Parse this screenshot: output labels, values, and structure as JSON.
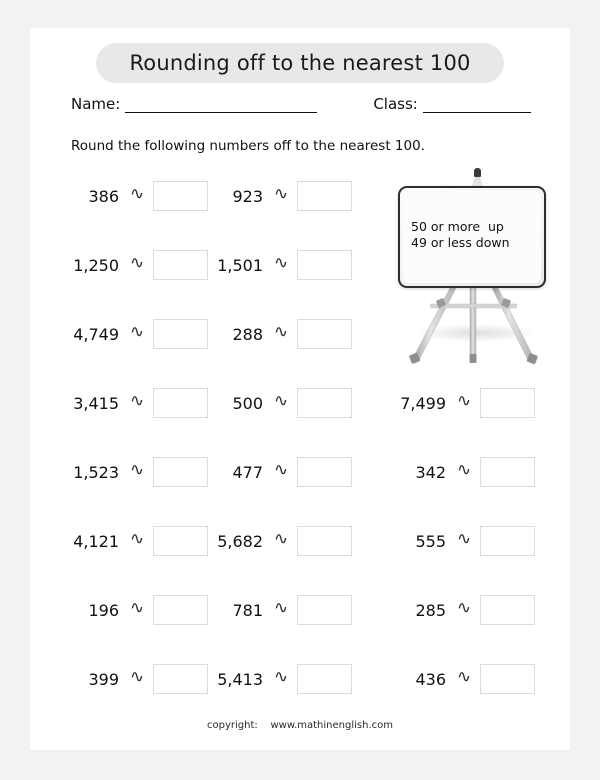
{
  "page": {
    "title": "Rounding off to the nearest 100",
    "instruction": "Round the following numbers off to the nearest 100.",
    "footer": "copyright:    www.mathinenglish.com"
  },
  "fields": {
    "name_label": "Name:",
    "class_label": "Class:",
    "name_value": "",
    "class_value": ""
  },
  "easel": {
    "line1": "50 or more  up",
    "line2": "49 or less down"
  },
  "symbols": {
    "approx": "∿"
  },
  "problems": {
    "rows": [
      {
        "col1": "386",
        "col2": "923",
        "col3": ""
      },
      {
        "col1": "1,250",
        "col2": "1,501",
        "col3": ""
      },
      {
        "col1": "4,749",
        "col2": "288",
        "col3": ""
      },
      {
        "col1": "3,415",
        "col2": "500",
        "col3": "7,499"
      },
      {
        "col1": "1,523",
        "col2": "477",
        "col3": "342"
      },
      {
        "col1": "4,121",
        "col2": "5,682",
        "col3": "555"
      },
      {
        "col1": "196",
        "col2": "781",
        "col3": "285"
      },
      {
        "col1": "399",
        "col2": "5,413",
        "col3": "436"
      }
    ],
    "answers": {
      "r0c1": "",
      "r0c2": "",
      "r0c3": "",
      "r1c1": "",
      "r1c2": "",
      "r1c3": "",
      "r2c1": "",
      "r2c2": "",
      "r2c3": "",
      "r3c1": "",
      "r3c2": "",
      "r3c3": "",
      "r4c1": "",
      "r4c2": "",
      "r4c3": "",
      "r5c1": "",
      "r5c2": "",
      "r5c3": "",
      "r6c1": "",
      "r6c2": "",
      "r6c3": "",
      "r7c1": "",
      "r7c2": "",
      "r7c3": ""
    }
  },
  "colors": {
    "page_background": "#f2f2f2",
    "sheet": "#ffffff",
    "title_pill": "#e8e8e8",
    "box_border": "#dcdcdc",
    "ink": "#111111"
  }
}
